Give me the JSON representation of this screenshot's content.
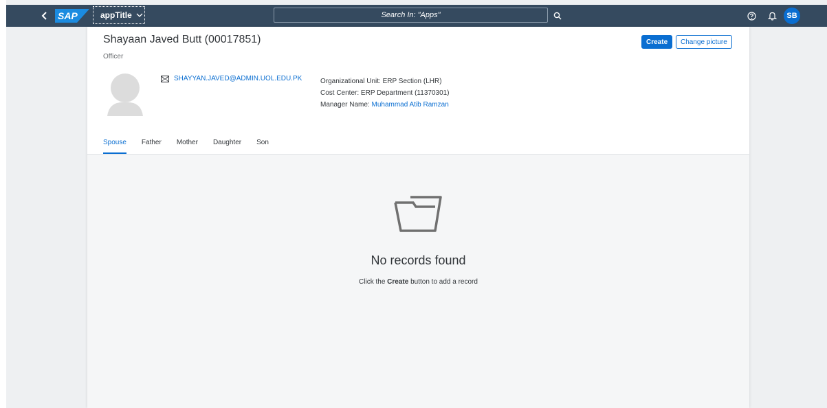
{
  "shell": {
    "logo_text": "SAP",
    "app_title": "appTitle",
    "search_placeholder": "Search In: \"Apps\"",
    "avatar_initials": "SB"
  },
  "employee": {
    "name": "Shayaan Javed Butt (00017851)",
    "role": "Officer",
    "email": "SHAYYAN.JAVED@ADMIN.UOL.EDU.PK",
    "org_unit_label": "Organizational Unit:",
    "org_unit_value": "ERP Section (LHR)",
    "cost_center_label": "Cost Center:",
    "cost_center_value": "ERP Department (11370301)",
    "manager_label": "Manager Name:",
    "manager_value": "Muhammad Atib Ramzan"
  },
  "actions": {
    "create_label": "Create",
    "change_picture_label": "Change picture"
  },
  "tabs": [
    {
      "label": "Spouse",
      "active": true
    },
    {
      "label": "Father",
      "active": false
    },
    {
      "label": "Mother",
      "active": false
    },
    {
      "label": "Daughter",
      "active": false
    },
    {
      "label": "Son",
      "active": false
    }
  ],
  "empty_state": {
    "title": "No records found",
    "sub_prefix": "Click the",
    "sub_bold": "Create",
    "sub_suffix": "button to add a record"
  },
  "colors": {
    "shell_bg": "#354a5f",
    "accent": "#0a6ed1",
    "page_bg": "#eef0f2",
    "content_bg": "#f5f6f7"
  },
  "icons": [
    "back-arrow-icon",
    "chevron-down-icon",
    "search-icon",
    "help-icon",
    "bell-icon",
    "email-icon",
    "person-placeholder-icon",
    "empty-folder-icon"
  ]
}
